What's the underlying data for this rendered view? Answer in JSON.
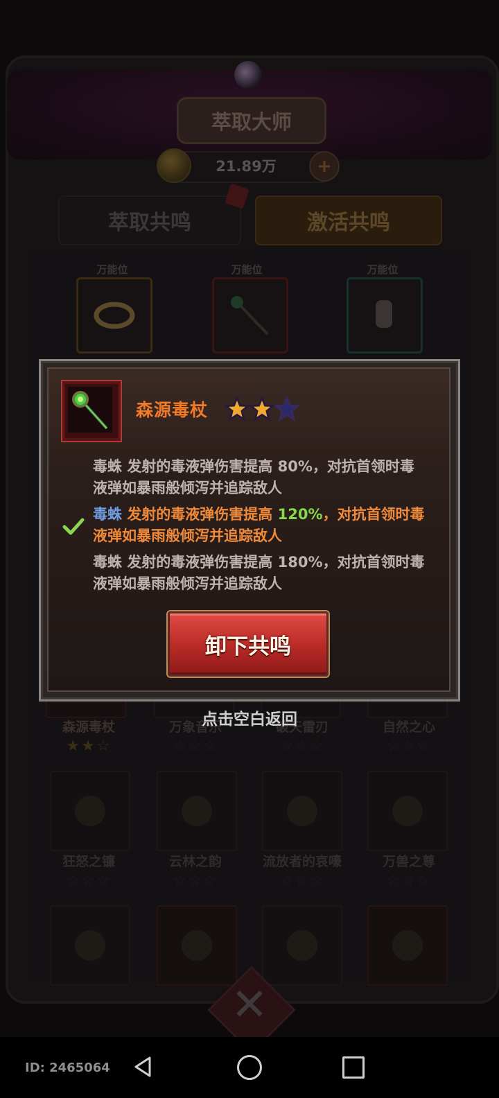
{
  "header": {
    "title": "萃取大师",
    "currency_amount": "21.89万"
  },
  "tabs": [
    {
      "label": "萃取共鸣"
    },
    {
      "label": "激活共鸣"
    }
  ],
  "slots": {
    "label": "万能位"
  },
  "grid": {
    "row1_names": [
      "森源毒杖",
      "万象音乐",
      "破天雷刃",
      "自然之心"
    ],
    "row2_names": [
      "狂怒之镰",
      "云林之韵",
      "流放者的哀嚎",
      "万兽之尊"
    ]
  },
  "dialog": {
    "item_name": "森源毒杖",
    "stars": {
      "filled": 2,
      "total": 3
    },
    "levels": [
      {
        "pet": "毒蛛",
        "pre": "发射的毒液弹伤害提高 ",
        "value": "80%",
        "post": "，对抗首领时毒液弹如暴雨般倾泻并追踪敌人",
        "active": false
      },
      {
        "pet": "毒蛛",
        "pre": "发射的毒液弹伤害提高 ",
        "value": "120%",
        "post": "，对抗首领时毒液弹如暴雨般倾泻并追踪敌人",
        "active": true
      },
      {
        "pet": "毒蛛",
        "pre": "发射的毒液弹伤害提高 ",
        "value": "180%",
        "post": "，对抗首领时毒液弹如暴雨般倾泻并追踪敌人",
        "active": false
      }
    ],
    "button_label": "卸下共鸣",
    "close_hint": "点击空白返回"
  },
  "navbar": {
    "device_id": "ID: 2465064"
  },
  "colors": {
    "accent_orange": "#f07a2a",
    "highlight_blue": "#6f9de0",
    "highlight_green": "#86d94a",
    "button_red": "#c0302c"
  }
}
